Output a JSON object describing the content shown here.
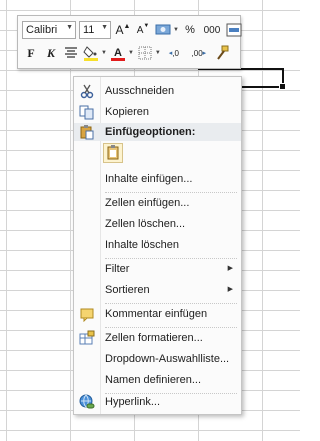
{
  "toolbar": {
    "font_name": "Calibri",
    "font_size": "11",
    "grow_font": "A",
    "shrink_font": "A",
    "percent": "%",
    "thousands": "000",
    "bold": "F",
    "italic": "K",
    "increase_decimal": ",0",
    "decrease_decimal": ",00",
    "fill_color": "#f7e02a",
    "font_color": "#e21c1c"
  },
  "menu": {
    "items": [
      {
        "label": "Ausschneiden",
        "icon": "scissors-icon"
      },
      {
        "label": "Kopieren",
        "icon": "copy-icon"
      },
      {
        "label": "Einfügeoptionen:",
        "icon": "paste-icon"
      },
      {
        "label": "Inhalte einfügen..."
      },
      {
        "label": "Zellen einfügen..."
      },
      {
        "label": "Zellen löschen..."
      },
      {
        "label": "Inhalte löschen"
      },
      {
        "label": "Filter"
      },
      {
        "label": "Sortieren"
      },
      {
        "label": "Kommentar einfügen",
        "icon": "comment-icon"
      },
      {
        "label": "Zellen formatieren...",
        "icon": "format-cells-icon"
      },
      {
        "label": "Dropdown-Auswahlliste..."
      },
      {
        "label": "Namen definieren..."
      },
      {
        "label": "Hyperlink...",
        "icon": "hyperlink-icon"
      }
    ]
  }
}
